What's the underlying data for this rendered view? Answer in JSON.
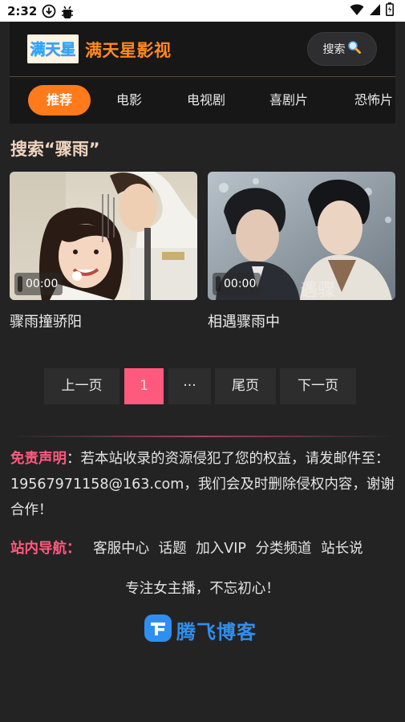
{
  "status_bar": {
    "time": "2:32",
    "icons": [
      "download-icon",
      "debug-icon",
      "wifi-icon",
      "signal-icon",
      "battery-icon"
    ]
  },
  "header": {
    "logo_text": "满天星",
    "site_name": "满天星影视",
    "search_label": "搜索",
    "accent_color": "#ff8a1f"
  },
  "nav": {
    "tabs": [
      {
        "label": "推荐",
        "active": true
      },
      {
        "label": "电影",
        "active": false
      },
      {
        "label": "电视剧",
        "active": false
      },
      {
        "label": "喜剧片",
        "active": false
      },
      {
        "label": "恐怖片",
        "active": false
      }
    ]
  },
  "search": {
    "heading": "搜索“骤雨”"
  },
  "results": [
    {
      "title": "骤雨撞骄阳",
      "duration": "00:00"
    },
    {
      "title": "相遇骤雨中",
      "duration": "00:00"
    }
  ],
  "pagination": {
    "prev": "上一页",
    "current": "1",
    "ellipsis": "···",
    "last": "尾页",
    "next": "下一页",
    "active_color": "#ff5a7e"
  },
  "footer": {
    "disclaimer_label": "免责声明",
    "disclaimer_text": "：若本站收录的资源侵犯了您的权益，请发邮件至：19567971158@163.com，我们会及时删除侵权内容，谢谢合作！",
    "sitenav_label": "站内导航：",
    "sitenav_links": [
      "客服中心",
      "话题",
      "加入VIP",
      "分类频道",
      "站长说"
    ],
    "slogan": "专注女主播，不忘初心！",
    "brand_name": "腾飞博客",
    "brand_color": "#2f8ff0"
  }
}
